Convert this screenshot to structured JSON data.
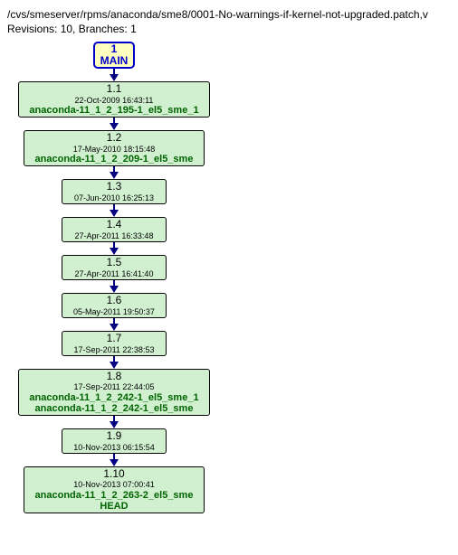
{
  "header": {
    "path": "/cvs/smeserver/rpms/anaconda/sme8/0001-No-warnings-if-kernel-not-upgraded.patch,v",
    "stats": "Revisions: 10, Branches: 1"
  },
  "branch": {
    "num": "1",
    "name": "MAIN"
  },
  "revisions": [
    {
      "rev": "1.1",
      "date": "22-Oct-2009 16:43:11",
      "tags": [
        "anaconda-11_1_2_195-1_el5_sme_1"
      ]
    },
    {
      "rev": "1.2",
      "date": "17-May-2010 18:15:48",
      "tags": [
        "anaconda-11_1_2_209-1_el5_sme"
      ]
    },
    {
      "rev": "1.3",
      "date": "07-Jun-2010 16:25:13",
      "tags": []
    },
    {
      "rev": "1.4",
      "date": "27-Apr-2011 16:33:48",
      "tags": []
    },
    {
      "rev": "1.5",
      "date": "27-Apr-2011 16:41:40",
      "tags": []
    },
    {
      "rev": "1.6",
      "date": "05-May-2011 19:50:37",
      "tags": []
    },
    {
      "rev": "1.7",
      "date": "17-Sep-2011 22:38:53",
      "tags": []
    },
    {
      "rev": "1.8",
      "date": "17-Sep-2011 22:44:05",
      "tags": [
        "anaconda-11_1_2_242-1_el5_sme_1",
        "anaconda-11_1_2_242-1_el5_sme"
      ]
    },
    {
      "rev": "1.9",
      "date": "10-Nov-2013 06:15:54",
      "tags": []
    },
    {
      "rev": "1.10",
      "date": "10-Nov-2013 07:00:41",
      "tags": [
        "anaconda-11_1_2_263-2_el5_sme",
        "HEAD"
      ]
    }
  ]
}
